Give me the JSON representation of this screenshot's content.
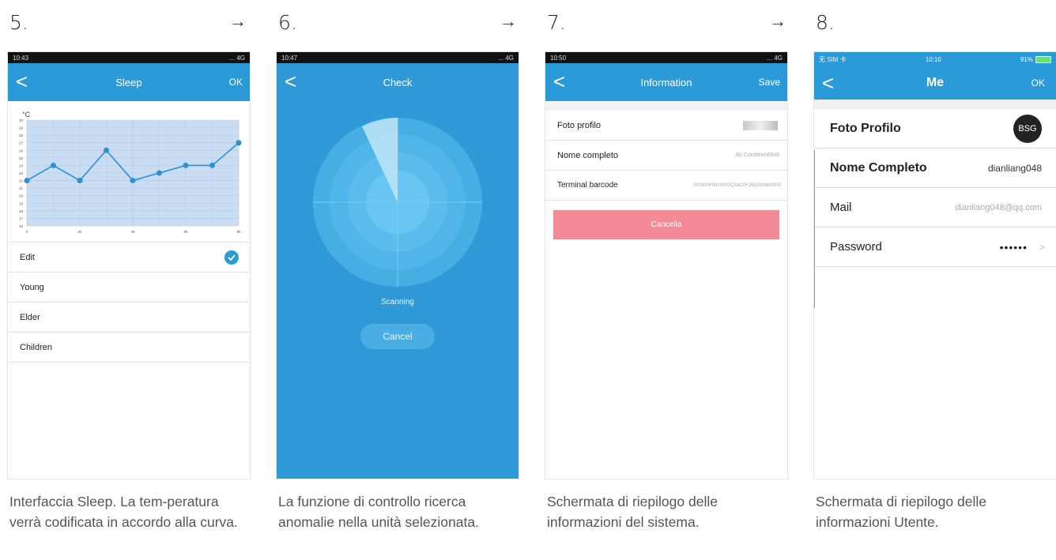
{
  "steps": [
    {
      "num": "5.",
      "caption": "Interfaccia Sleep. La tem-peratura verrà codificata in accordo alla curva."
    },
    {
      "num": "6.",
      "caption": "La funzione di controllo ricerca anomalie nella unità selezionata."
    },
    {
      "num": "7.",
      "caption": "Schermata di riepilogo delle informazioni del sistema."
    },
    {
      "num": "8.",
      "caption": "Schermata di riepilogo delle informazioni Utente."
    }
  ],
  "arrows": [
    "→",
    "→",
    "→"
  ],
  "sleep": {
    "status_time": "10:43",
    "status_right": "... 4G",
    "back": "<",
    "title": "Sleep",
    "ok": "OK",
    "unit": "°C",
    "y_ticks": [
      "30",
      "29",
      "28",
      "27",
      "26",
      "25",
      "24",
      "23",
      "22",
      "21",
      "20",
      "19",
      "18",
      "17",
      "16"
    ],
    "x_ticks": [
      "0",
      "2h",
      "4h",
      "6h",
      "8h"
    ],
    "modes": [
      {
        "label": "Edit",
        "checked": true
      },
      {
        "label": "Young",
        "checked": false
      },
      {
        "label": "Elder",
        "checked": false
      },
      {
        "label": "Children",
        "checked": false
      }
    ]
  },
  "chart_data": {
    "type": "line",
    "title": "",
    "xlabel": "",
    "ylabel": "°C",
    "x": [
      0,
      1,
      2,
      3,
      4,
      5,
      6,
      7,
      8
    ],
    "series": [
      {
        "values": [
          22,
          24,
          22,
          26,
          22,
          23,
          24,
          24,
          27
        ]
      }
    ],
    "ylim": [
      16,
      30
    ],
    "xlim": [
      0,
      8
    ],
    "grid": true
  },
  "check": {
    "status_time": "10:47",
    "status_right": "... 4G",
    "back": "<",
    "title": "Check",
    "scanning": "Scanning",
    "cancel": "Cancel"
  },
  "info": {
    "status_time": "10:50",
    "status_right": "... 4G",
    "back": "<",
    "title": "Information",
    "save": "Save",
    "rows": [
      {
        "label": "Foto profilo",
        "value": ""
      },
      {
        "label": "Nome completo",
        "value": "Air Condition6848"
      },
      {
        "label": "Terminal barcode",
        "value": "000000P0000000Q18C0F2BA068480000"
      }
    ],
    "delete": "Cancella"
  },
  "me": {
    "status_left": "无 SIM 卡 ",
    "status_time": "10:10",
    "status_right": "91%",
    "back": "<",
    "title": "Me",
    "ok": "OK",
    "avatar": "BSG",
    "rows": [
      {
        "label": "Foto Profilo",
        "value": ""
      },
      {
        "label": "Nome Completo",
        "value": "dianliang048"
      },
      {
        "label": "Mail",
        "value": "dianliang048@qq.com"
      },
      {
        "label": "Password",
        "value": "••••••"
      }
    ],
    "chevron": ">"
  },
  "colors": {
    "accent": "#2b9ad8",
    "delete": "#f28b95",
    "check_bg": "#2f9ad7"
  }
}
